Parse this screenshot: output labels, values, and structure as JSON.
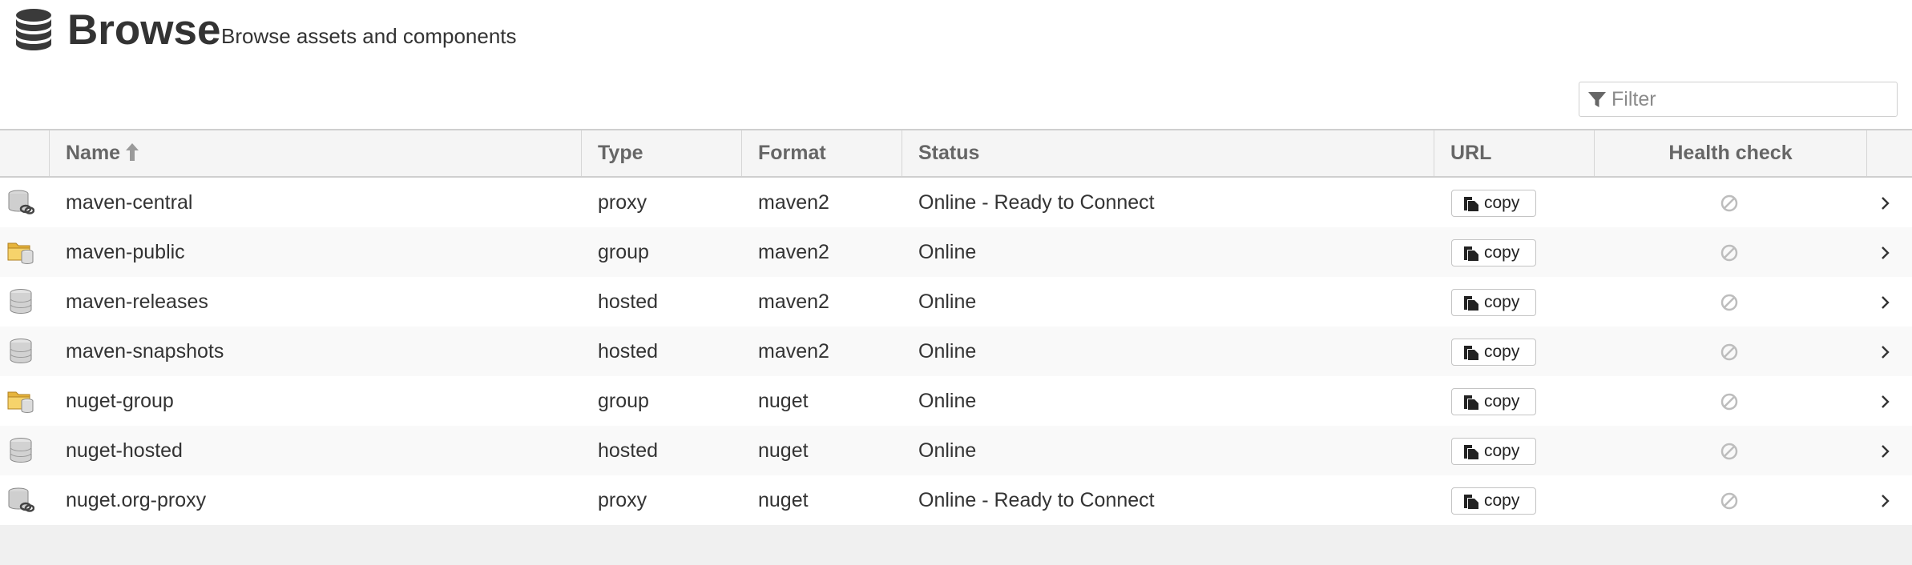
{
  "header": {
    "icon": "database-icon",
    "title": "Browse",
    "subtitle": "Browse assets and components"
  },
  "filter": {
    "icon": "filter-icon",
    "placeholder": "Filter",
    "value": ""
  },
  "table": {
    "columns": {
      "name": "Name",
      "type": "Type",
      "format": "Format",
      "status": "Status",
      "url": "URL",
      "health": "Health check"
    },
    "sort": {
      "column": "Name",
      "direction": "ascending",
      "icon": "sort-up-arrow-icon"
    },
    "rows": [
      {
        "icon": "proxy-repo-icon",
        "name": "maven-central",
        "type": "proxy",
        "format": "maven2",
        "status": "Online - Ready to Connect",
        "url_button": "copy",
        "health_icon": "disabled-circle-icon",
        "open_icon": "chevron-right-icon"
      },
      {
        "icon": "group-repo-icon",
        "name": "maven-public",
        "type": "group",
        "format": "maven2",
        "status": "Online",
        "url_button": "copy",
        "health_icon": "disabled-circle-icon",
        "open_icon": "chevron-right-icon"
      },
      {
        "icon": "hosted-repo-icon",
        "name": "maven-releases",
        "type": "hosted",
        "format": "maven2",
        "status": "Online",
        "url_button": "copy",
        "health_icon": "disabled-circle-icon",
        "open_icon": "chevron-right-icon"
      },
      {
        "icon": "hosted-repo-icon",
        "name": "maven-snapshots",
        "type": "hosted",
        "format": "maven2",
        "status": "Online",
        "url_button": "copy",
        "health_icon": "disabled-circle-icon",
        "open_icon": "chevron-right-icon"
      },
      {
        "icon": "group-repo-icon",
        "name": "nuget-group",
        "type": "group",
        "format": "nuget",
        "status": "Online",
        "url_button": "copy",
        "health_icon": "disabled-circle-icon",
        "open_icon": "chevron-right-icon"
      },
      {
        "icon": "hosted-repo-icon",
        "name": "nuget-hosted",
        "type": "hosted",
        "format": "nuget",
        "status": "Online",
        "url_button": "copy",
        "health_icon": "disabled-circle-icon",
        "open_icon": "chevron-right-icon"
      },
      {
        "icon": "proxy-repo-icon",
        "name": "nuget.org-proxy",
        "type": "proxy",
        "format": "nuget",
        "status": "Online - Ready to Connect",
        "url_button": "copy",
        "health_icon": "disabled-circle-icon",
        "open_icon": "chevron-right-icon"
      }
    ]
  },
  "colors": {
    "text": "#333333",
    "header_text": "#666666",
    "grid_background": "#f0f0f0",
    "row_alt": "#f9f9f9",
    "folder_yellow": "#f3c64b"
  }
}
